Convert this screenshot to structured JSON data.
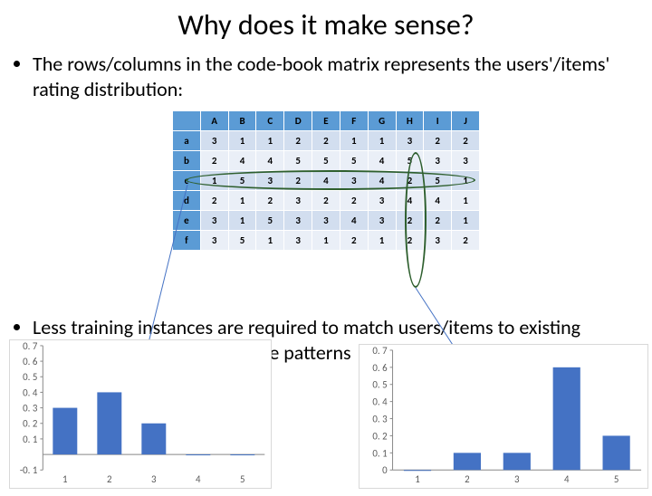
{
  "title": "Why does it make sense?",
  "bullet1": "The rows/columns in the code-book matrix represents the users'/items' rating distribution:",
  "bullet2": "Less training instances are required to match users/items to existing patterns than rediscover these patterns",
  "table": {
    "cols": [
      "A",
      "B",
      "C",
      "D",
      "E",
      "F",
      "G",
      "H",
      "I",
      "J"
    ],
    "rows": [
      {
        "h": "a",
        "v": [
          3,
          1,
          1,
          2,
          2,
          1,
          1,
          3,
          2,
          2
        ]
      },
      {
        "h": "b",
        "v": [
          2,
          4,
          4,
          5,
          5,
          5,
          4,
          5,
          3,
          3
        ]
      },
      {
        "h": "c",
        "v": [
          1,
          5,
          3,
          2,
          4,
          3,
          4,
          2,
          5,
          1
        ]
      },
      {
        "h": "d",
        "v": [
          2,
          1,
          2,
          3,
          2,
          2,
          3,
          4,
          4,
          1
        ]
      },
      {
        "h": "e",
        "v": [
          3,
          1,
          5,
          3,
          3,
          4,
          3,
          2,
          2,
          1
        ]
      },
      {
        "h": "f",
        "v": [
          3,
          5,
          1,
          3,
          1,
          2,
          1,
          2,
          3,
          2
        ]
      }
    ]
  },
  "chart_data": [
    {
      "type": "bar",
      "categories": [
        "1",
        "2",
        "3",
        "4",
        "5"
      ],
      "values": [
        0.3,
        0.4,
        0.2,
        0.0,
        0.0
      ],
      "xlabel": "",
      "ylabel": "",
      "ylim": [
        -0.1,
        0.7
      ],
      "yticks": [
        -0.1,
        0.1,
        0.2,
        0.3,
        0.4,
        0.5,
        0.6,
        0.7
      ]
    },
    {
      "type": "bar",
      "categories": [
        "1",
        "2",
        "3",
        "4",
        "5"
      ],
      "values": [
        0.0,
        0.1,
        0.1,
        0.6,
        0.2
      ],
      "xlabel": "",
      "ylabel": "",
      "ylim": [
        0,
        0.7
      ],
      "yticks": [
        0,
        0.1,
        0.2,
        0.3,
        0.4,
        0.5,
        0.6,
        0.7
      ]
    }
  ]
}
